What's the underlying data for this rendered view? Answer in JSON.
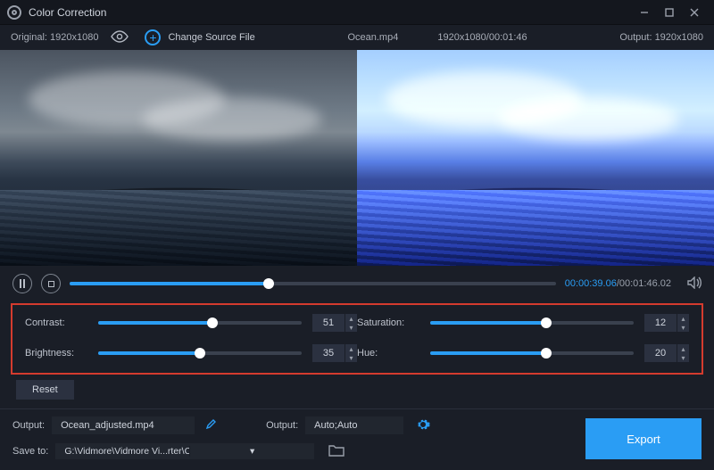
{
  "window": {
    "title": "Color Correction"
  },
  "header": {
    "original_label": "Original:",
    "original_res": "1920x1080",
    "change_source": "Change Source File",
    "file_name": "Ocean.mp4",
    "res_duration": "1920x1080/00:01:46",
    "output_label": "Output:",
    "output_res": "1920x1080"
  },
  "playback": {
    "progress_pct": 41,
    "time_current": "00:00:39.06",
    "time_total": "/00:01:46.02"
  },
  "adjust": {
    "contrast": {
      "label": "Contrast:",
      "value": 51,
      "pct": 56
    },
    "brightness": {
      "label": "Brightness:",
      "value": 35,
      "pct": 50
    },
    "saturation": {
      "label": "Saturation:",
      "value": 12,
      "pct": 57
    },
    "hue": {
      "label": "Hue:",
      "value": 20,
      "pct": 57
    }
  },
  "reset_label": "Reset",
  "output": {
    "file_label": "Output:",
    "file_name": "Ocean_adjusted.mp4",
    "format_label": "Output:",
    "format_value": "Auto;Auto"
  },
  "save": {
    "label": "Save to:",
    "path": "G:\\Vidmore\\Vidmore Vi...rter\\Color Correction"
  },
  "export_label": "Export"
}
